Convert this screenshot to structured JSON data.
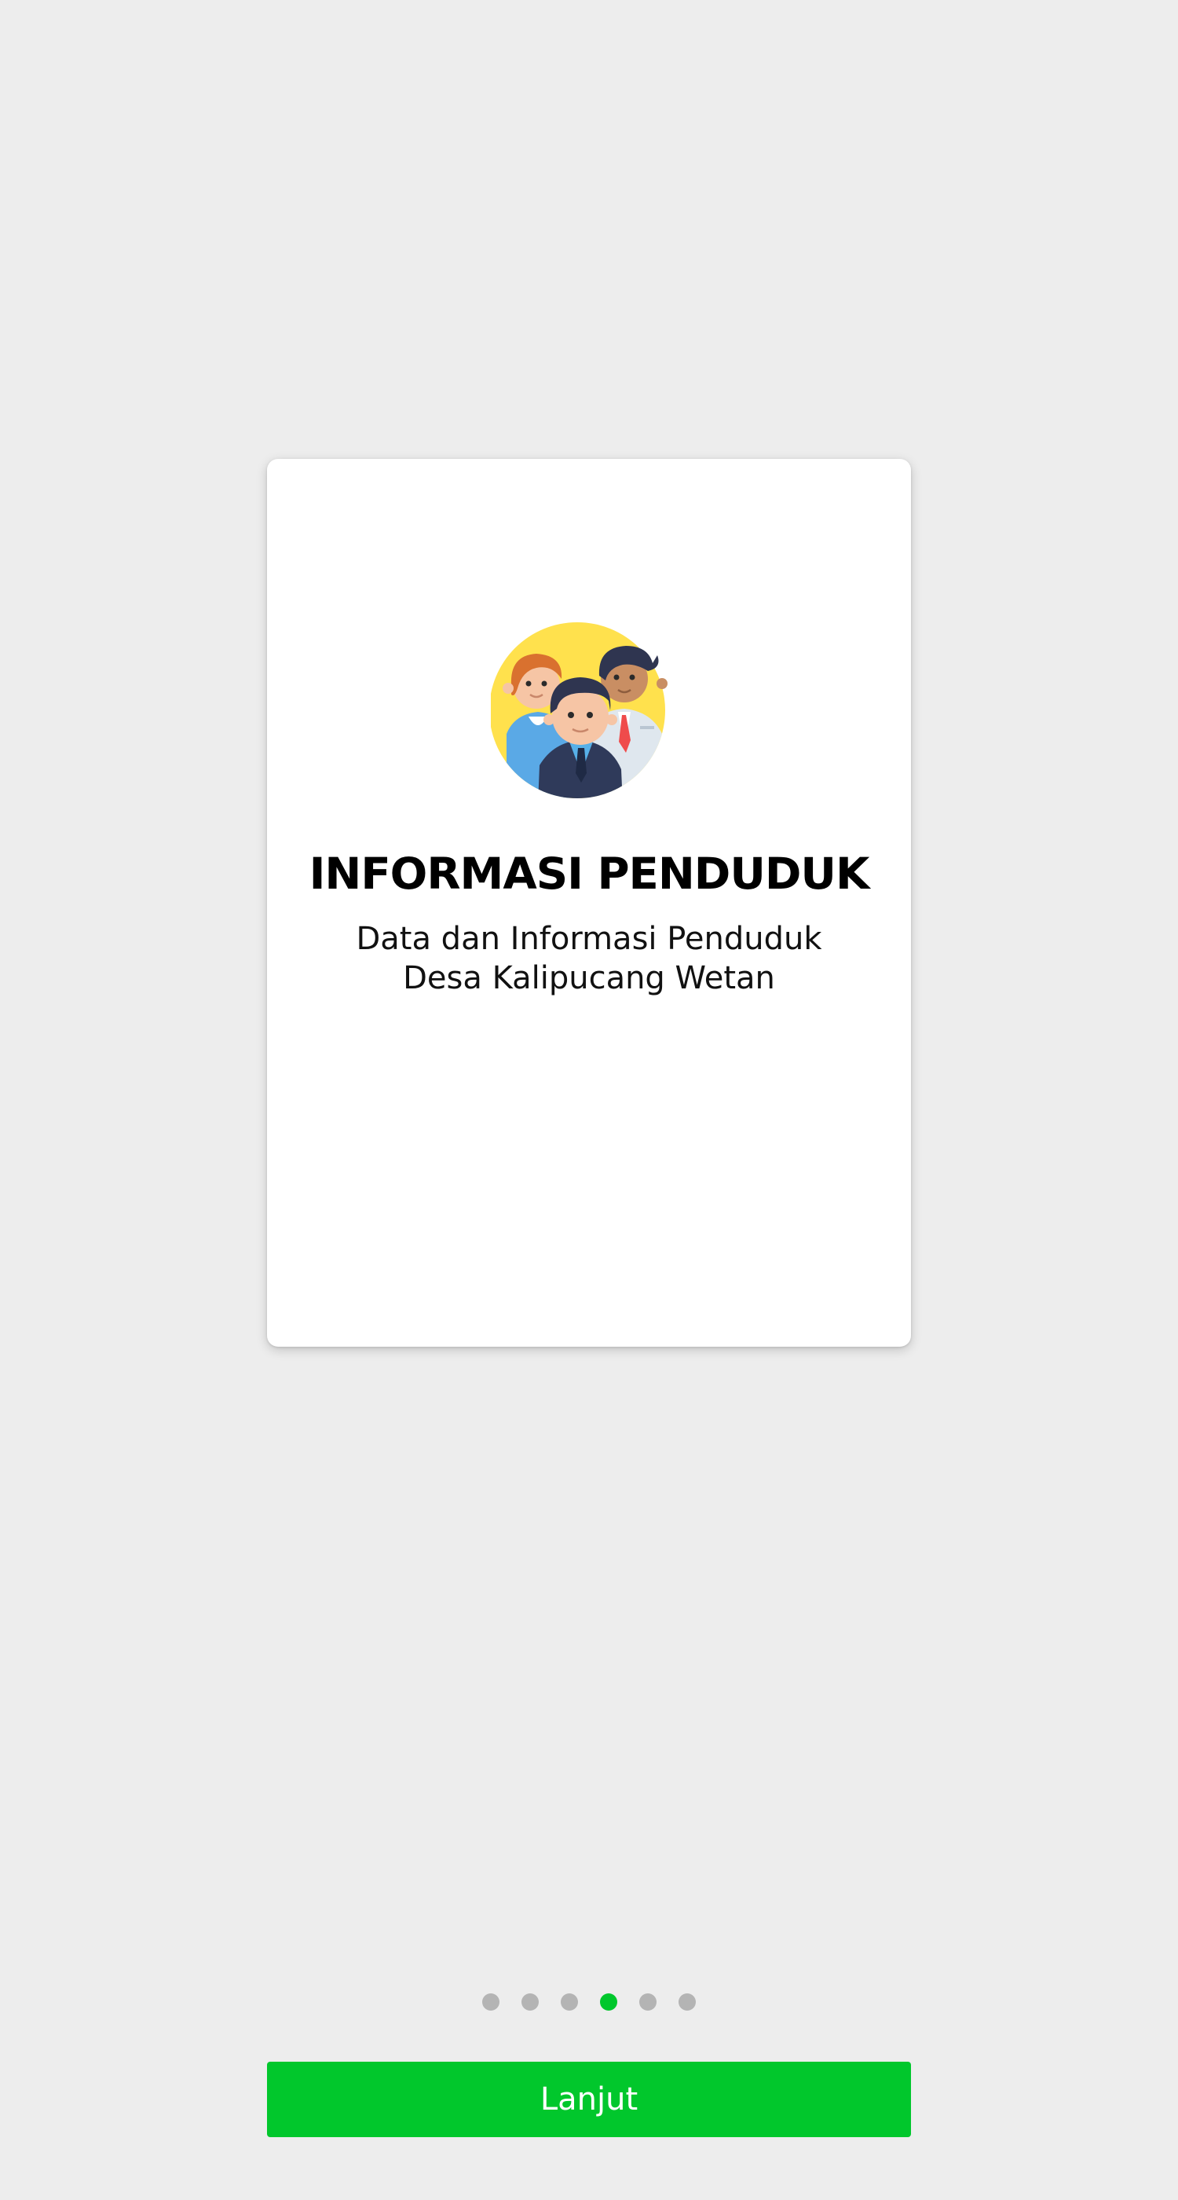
{
  "card": {
    "title": "INFORMASI PENDUDUK",
    "subtitle_line1": "Data dan Informasi Penduduk",
    "subtitle_line2": "Desa Kalipucang Wetan",
    "illustration_icon": "people-group-icon"
  },
  "pagination": {
    "total": 6,
    "current": 4,
    "active_color": "#01c72c",
    "inactive_color": "#b4b4b4"
  },
  "button": {
    "label": "Lanjut",
    "color": "#01c72c"
  }
}
